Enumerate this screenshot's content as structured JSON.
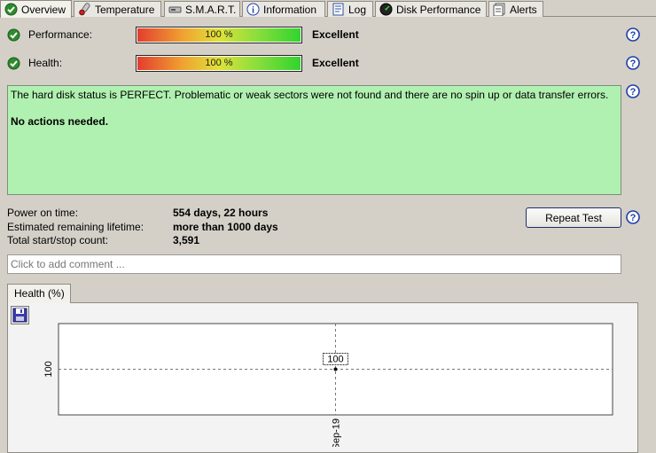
{
  "tabs": [
    {
      "label": "Overview",
      "icon": "check-circle-icon",
      "active": true
    },
    {
      "label": "Temperature",
      "icon": "thermometer-icon",
      "active": false
    },
    {
      "label": "S.M.A.R.T.",
      "icon": "drive-icon",
      "active": false
    },
    {
      "label": "Information",
      "icon": "info-icon",
      "active": false
    },
    {
      "label": "Log",
      "icon": "log-icon",
      "active": false
    },
    {
      "label": "Disk Performance",
      "icon": "gauge-icon",
      "active": false
    },
    {
      "label": "Alerts",
      "icon": "alerts-icon",
      "active": false
    }
  ],
  "performance": {
    "label": "Performance:",
    "percent": 100,
    "percent_text": "100 %",
    "rating": "Excellent"
  },
  "health": {
    "label": "Health:",
    "percent": 100,
    "percent_text": "100 %",
    "rating": "Excellent"
  },
  "status": {
    "message": "The hard disk status is PERFECT. Problematic or weak sectors were not found and there are no spin up or data transfer errors.",
    "action": "No actions needed."
  },
  "stats": {
    "power_on_label": "Power on time:",
    "power_on_value": "554 days, 22 hours",
    "lifetime_label": "Estimated remaining lifetime:",
    "lifetime_value": "more than 1000 days",
    "startstop_label": "Total start/stop count:",
    "startstop_value": "3,591"
  },
  "repeat_test_label": "Repeat Test",
  "comment_placeholder": "Click to add comment ...",
  "chart_tab_label": "Health (%)",
  "colors": {
    "status_bg": "#b0f0b0",
    "help_icon": "#1f3fa8",
    "ok_icon": "#2e8b2e"
  },
  "chart_data": {
    "type": "line",
    "x": [
      "Sep-19"
    ],
    "series": [
      {
        "values": [
          100
        ]
      }
    ],
    "ytick_labels": [
      "100"
    ],
    "xtick_labels": [
      "Sep-19"
    ],
    "data_labels": [
      "100"
    ],
    "grid": true
  }
}
